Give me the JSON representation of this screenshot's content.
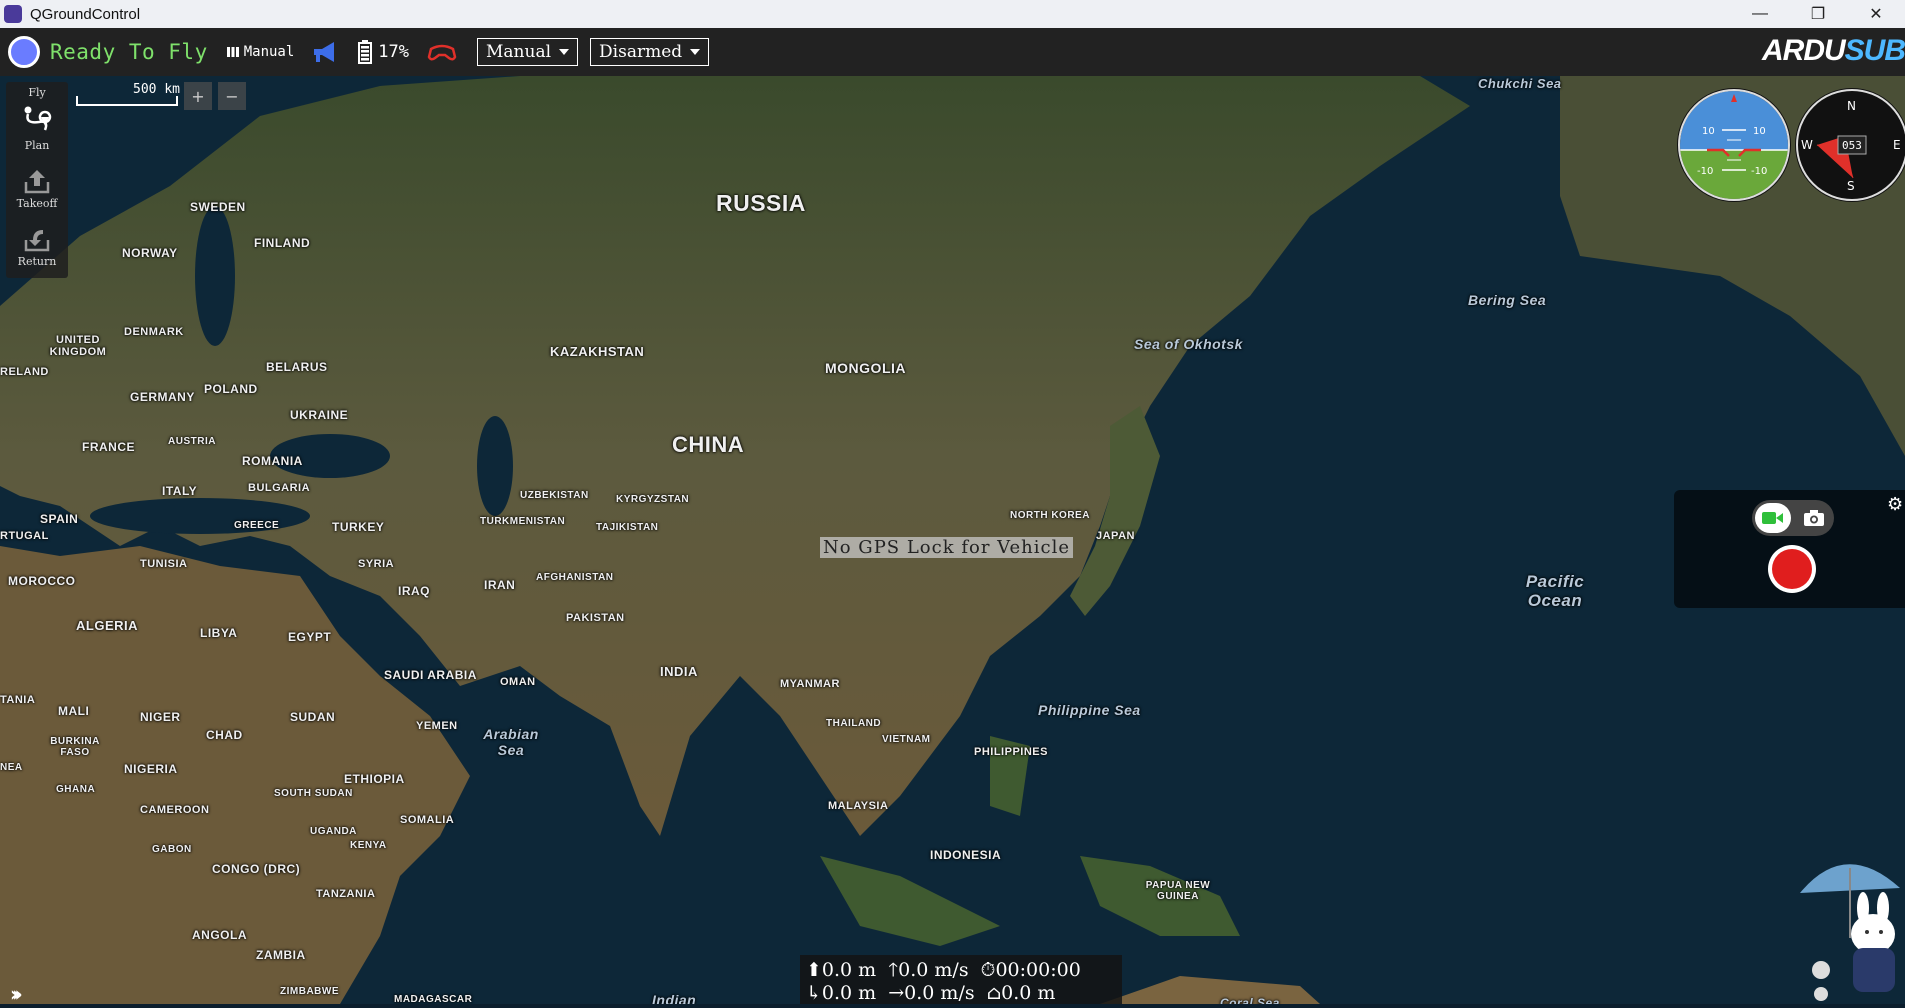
{
  "window": {
    "title": "QGroundControl",
    "controls": {
      "minimize": "—",
      "restore": "❐",
      "close": "✕"
    }
  },
  "toolbar": {
    "status": "Ready To Fly",
    "flight_mode_indicator": "Manual",
    "battery_percent": "17%",
    "flight_mode_select": "Manual",
    "arm_select": "Disarmed",
    "brand_prefix": "ARDU",
    "brand_suffix": "SUB"
  },
  "left_toolbar": {
    "fly_label": "Fly",
    "items": [
      {
        "label": "Plan",
        "icon": "plan-icon"
      },
      {
        "label": "Takeoff",
        "icon": "takeoff-icon"
      },
      {
        "label": "Return",
        "icon": "return-icon"
      }
    ]
  },
  "map": {
    "scale_label": "500 km",
    "zoom_in": "+",
    "zoom_out": "−",
    "gps_message": "No GPS Lock for Vehicle",
    "countries": {
      "russia": "RUSSIA",
      "china": "CHINA",
      "mongolia": "MONGOLIA",
      "kazakhstan": "KAZAKHSTAN",
      "india": "INDIA",
      "sweden": "SWEDEN",
      "finland": "FINLAND",
      "norway": "NORWAY",
      "denmark": "DENMARK",
      "uk": "UNITED KINGDOM",
      "ireland": "RELAND",
      "belarus": "BELARUS",
      "germany": "GERMANY",
      "poland": "POLAND",
      "ukraine": "UKRAINE",
      "france": "FRANCE",
      "austria": "AUSTRIA",
      "romania": "ROMANIA",
      "italy": "ITALY",
      "bulgaria": "BULGARIA",
      "spain": "SPAIN",
      "portugal": "RTUGAL",
      "greece": "GREECE",
      "turkey": "TURKEY",
      "tunisia": "TUNISIA",
      "syria": "SYRIA",
      "iraq": "IRAQ",
      "iran": "IRAN",
      "morocco": "MOROCCO",
      "algeria": "ALGERIA",
      "libya": "LIBYA",
      "egypt": "EGYPT",
      "saudi": "SAUDI ARABIA",
      "oman": "OMAN",
      "yemen": "YEMEN",
      "sudan": "SUDAN",
      "chad": "CHAD",
      "niger": "NIGER",
      "mali": "MALI",
      "mauritania": "TANIA",
      "nigeria": "NIGERIA",
      "burkina": "BURKINA FASO",
      "ghana": "GHANA",
      "guinea": "NEA",
      "cameroon": "CAMEROON",
      "south_sudan": "SOUTH SUDAN",
      "ethiopia": "ETHIOPIA",
      "somalia": "SOMALIA",
      "uganda": "UGANDA",
      "kenya": "KENYA",
      "gabon": "GABON",
      "congo": "CONGO (DRC)",
      "tanzania": "TANZANIA",
      "angola": "ANGOLA",
      "zambia": "ZAMBIA",
      "zimbabwe": "ZIMBABWE",
      "madagascar": "MADAGASCAR",
      "uzbekistan": "UZBEKISTAN",
      "turkmenistan": "TURKMENISTAN",
      "kyrgyzstan": "KYRGYZSTAN",
      "tajikistan": "TAJIKISTAN",
      "afghanistan": "AFGHANISTAN",
      "pakistan": "PAKISTAN",
      "myanmar": "MYANMAR",
      "thailand": "THAILAND",
      "vietnam": "VIETNAM",
      "philippines": "PHILIPPINES",
      "malaysia": "MALAYSIA",
      "indonesia": "INDONESIA",
      "png": "PAPUA NEW GUINEA",
      "north_korea": "NORTH KOREA",
      "japan": "JAPAN"
    },
    "seas": {
      "chukchi": "Chukchi Sea",
      "bering": "Bering Sea",
      "okhotsk": "Sea of Okhotsk",
      "pacific": "Pacific Ocean",
      "philippine": "Philippine Sea",
      "arabian": "Arabian Sea",
      "indian": "Indian",
      "coral": "Coral Sea"
    }
  },
  "instruments": {
    "pitch_up": "10",
    "pitch_down": "-10",
    "heading": "053",
    "compass": {
      "n": "N",
      "s": "S",
      "e": "E",
      "w": "W"
    }
  },
  "telemetry": {
    "altitude": "0.0 m",
    "climb_rate": "0.0 m/s",
    "flight_time": "00:00:00",
    "distance": "0.0 m",
    "ground_speed": "0.0 m/s",
    "home_distance": "0.0 m"
  },
  "colors": {
    "status_green": "#7fe16b",
    "record_red": "#e01e1e",
    "brand_blue": "#4db8ff",
    "sky": "#4a8fd8",
    "ground": "#6aa83a"
  }
}
